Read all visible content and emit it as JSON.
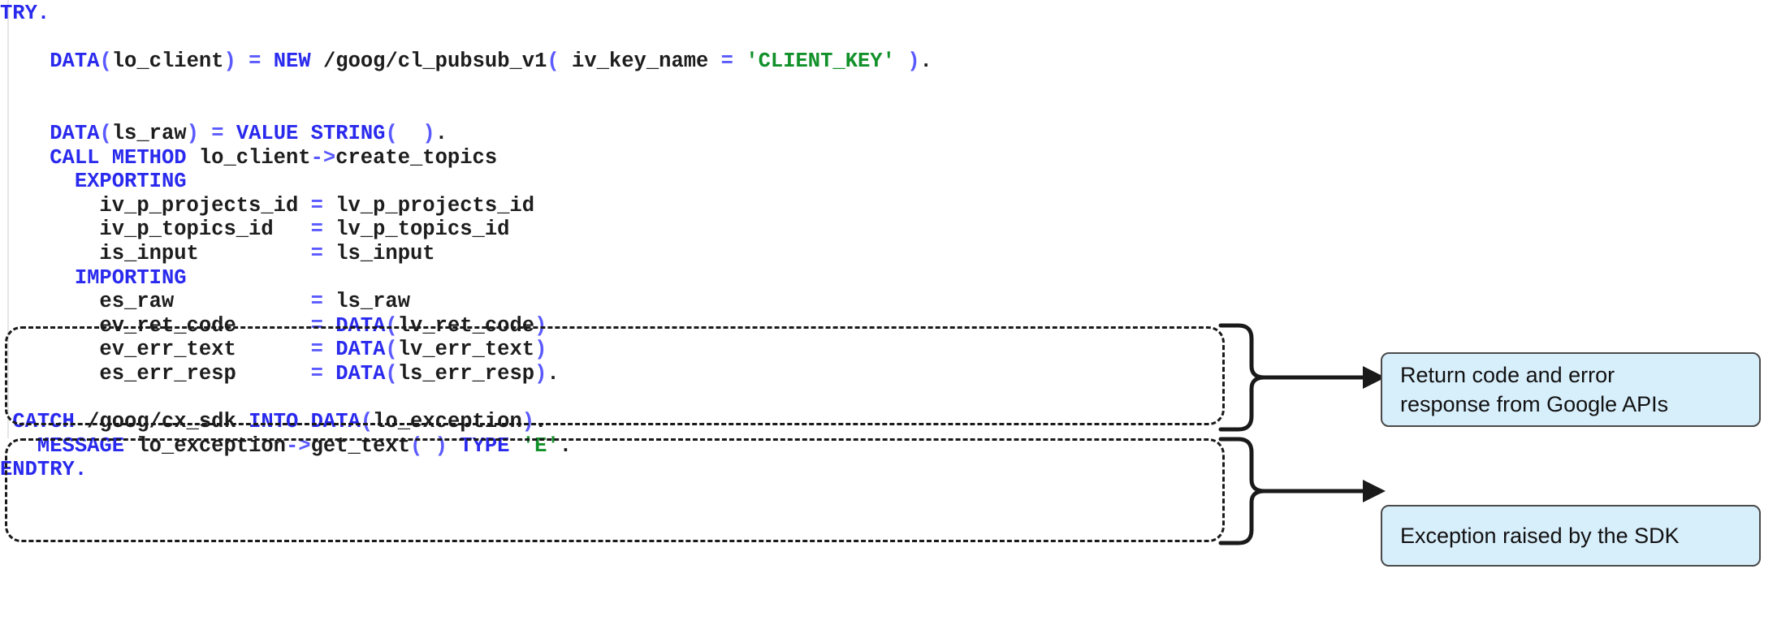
{
  "editor": {
    "language": "ABAP",
    "code_lines": [
      {
        "indent": 0,
        "tokens": [
          {
            "t": "TRY.",
            "c": "kw"
          }
        ]
      },
      {
        "indent": 0,
        "tokens": [
          {
            "t": "",
            "c": "id"
          }
        ]
      },
      {
        "indent": 4,
        "tokens": [
          {
            "t": "DATA",
            "c": "kw"
          },
          {
            "t": "(",
            "c": "op"
          },
          {
            "t": "lo_client",
            "c": "id"
          },
          {
            "t": ")",
            "c": "op"
          },
          {
            "t": " ",
            "c": "id"
          },
          {
            "t": "=",
            "c": "op"
          },
          {
            "t": " ",
            "c": "id"
          },
          {
            "t": "NEW",
            "c": "kw"
          },
          {
            "t": " /goog/cl_pubsub_v1",
            "c": "id"
          },
          {
            "t": "(",
            "c": "op"
          },
          {
            "t": " iv_key_name ",
            "c": "id"
          },
          {
            "t": "=",
            "c": "op"
          },
          {
            "t": " ",
            "c": "id"
          },
          {
            "t": "'CLIENT_KEY'",
            "c": "str"
          },
          {
            "t": " )",
            "c": "op"
          },
          {
            "t": ".",
            "c": "id"
          }
        ]
      },
      {
        "indent": 0,
        "tokens": [
          {
            "t": "",
            "c": "id"
          }
        ]
      },
      {
        "indent": 0,
        "tokens": [
          {
            "t": "",
            "c": "id"
          }
        ]
      },
      {
        "indent": 4,
        "tokens": [
          {
            "t": "DATA",
            "c": "kw"
          },
          {
            "t": "(",
            "c": "op"
          },
          {
            "t": "ls_raw",
            "c": "id"
          },
          {
            "t": ")",
            "c": "op"
          },
          {
            "t": " ",
            "c": "id"
          },
          {
            "t": "=",
            "c": "op"
          },
          {
            "t": " ",
            "c": "id"
          },
          {
            "t": "VALUE",
            "c": "kw"
          },
          {
            "t": " ",
            "c": "id"
          },
          {
            "t": "STRING",
            "c": "kw"
          },
          {
            "t": "(",
            "c": "op"
          },
          {
            "t": "  )",
            "c": "op"
          },
          {
            "t": ".",
            "c": "id"
          }
        ]
      },
      {
        "indent": 4,
        "tokens": [
          {
            "t": "CALL METHOD",
            "c": "kw"
          },
          {
            "t": " lo_client",
            "c": "id"
          },
          {
            "t": "->",
            "c": "op"
          },
          {
            "t": "create_topics",
            "c": "id"
          }
        ]
      },
      {
        "indent": 6,
        "tokens": [
          {
            "t": "EXPORTING",
            "c": "kw"
          }
        ]
      },
      {
        "indent": 8,
        "tokens": [
          {
            "t": "iv_p_projects_id ",
            "c": "id"
          },
          {
            "t": "=",
            "c": "op"
          },
          {
            "t": " lv_p_projects_id",
            "c": "id"
          }
        ]
      },
      {
        "indent": 8,
        "tokens": [
          {
            "t": "iv_p_topics_id   ",
            "c": "id"
          },
          {
            "t": "=",
            "c": "op"
          },
          {
            "t": " lv_p_topics_id",
            "c": "id"
          }
        ]
      },
      {
        "indent": 8,
        "tokens": [
          {
            "t": "is_input         ",
            "c": "id"
          },
          {
            "t": "=",
            "c": "op"
          },
          {
            "t": " ls_input",
            "c": "id"
          }
        ]
      },
      {
        "indent": 6,
        "tokens": [
          {
            "t": "IMPORTING",
            "c": "kw"
          }
        ]
      },
      {
        "indent": 8,
        "tokens": [
          {
            "t": "es_raw           ",
            "c": "id"
          },
          {
            "t": "=",
            "c": "op"
          },
          {
            "t": " ls_raw",
            "c": "id"
          }
        ]
      },
      {
        "indent": 8,
        "tokens": [
          {
            "t": "ev_ret_code      ",
            "c": "id"
          },
          {
            "t": "=",
            "c": "op"
          },
          {
            "t": " ",
            "c": "id"
          },
          {
            "t": "DATA",
            "c": "kw"
          },
          {
            "t": "(",
            "c": "op"
          },
          {
            "t": "lv_ret_code",
            "c": "id"
          },
          {
            "t": ")",
            "c": "op"
          }
        ]
      },
      {
        "indent": 8,
        "tokens": [
          {
            "t": "ev_err_text      ",
            "c": "id"
          },
          {
            "t": "=",
            "c": "op"
          },
          {
            "t": " ",
            "c": "id"
          },
          {
            "t": "DATA",
            "c": "kw"
          },
          {
            "t": "(",
            "c": "op"
          },
          {
            "t": "lv_err_text",
            "c": "id"
          },
          {
            "t": ")",
            "c": "op"
          }
        ]
      },
      {
        "indent": 8,
        "tokens": [
          {
            "t": "es_err_resp      ",
            "c": "id"
          },
          {
            "t": "=",
            "c": "op"
          },
          {
            "t": " ",
            "c": "id"
          },
          {
            "t": "DATA",
            "c": "kw"
          },
          {
            "t": "(",
            "c": "op"
          },
          {
            "t": "ls_err_resp",
            "c": "id"
          },
          {
            "t": ")",
            "c": "op"
          },
          {
            "t": ".",
            "c": "id"
          }
        ]
      },
      {
        "indent": 0,
        "tokens": [
          {
            "t": "",
            "c": "id"
          }
        ]
      },
      {
        "indent": 1,
        "tokens": [
          {
            "t": "CATCH",
            "c": "kw"
          },
          {
            "t": " /goog/cx_sdk ",
            "c": "id"
          },
          {
            "t": "INTO",
            "c": "kw"
          },
          {
            "t": " ",
            "c": "id"
          },
          {
            "t": "DATA",
            "c": "kw"
          },
          {
            "t": "(",
            "c": "op"
          },
          {
            "t": "lo_exception",
            "c": "id"
          },
          {
            "t": ")",
            "c": "op"
          },
          {
            "t": ".",
            "c": "id"
          }
        ]
      },
      {
        "indent": 3,
        "tokens": [
          {
            "t": "MESSAGE",
            "c": "kw"
          },
          {
            "t": " lo_exception",
            "c": "id"
          },
          {
            "t": "->",
            "c": "op"
          },
          {
            "t": "get_text",
            "c": "id"
          },
          {
            "t": "( )",
            "c": "op"
          },
          {
            "t": " ",
            "c": "id"
          },
          {
            "t": "TYPE",
            "c": "kw"
          },
          {
            "t": " ",
            "c": "id"
          },
          {
            "t": "'E'",
            "c": "str"
          },
          {
            "t": ".",
            "c": "id"
          }
        ]
      },
      {
        "indent": 0,
        "tokens": [
          {
            "t": "ENDTRY.",
            "c": "kw"
          }
        ]
      }
    ]
  },
  "highlights": [
    {
      "id": "importing-block",
      "label": "IMPORTING parameters highlight"
    },
    {
      "id": "catch-block",
      "label": "CATCH block highlight"
    }
  ],
  "callouts": [
    {
      "id": "return-code-callout",
      "text": "Return code and error\nresponse from Google APIs",
      "fill": "#d7eefb",
      "border": "#4a4a4a"
    },
    {
      "id": "exception-callout",
      "text": "Exception raised by the SDK",
      "fill": "#d7eefb",
      "border": "#4a4a4a"
    }
  ],
  "colors": {
    "keyword": "#2a2aee",
    "operator": "#5a5aff",
    "string": "#12912b",
    "identifier": "#1d1d1d",
    "callout_fill": "#d7eefb",
    "callout_border": "#4a4a4a",
    "dash_stroke": "#1a1a1a",
    "background": "#ffffff"
  }
}
